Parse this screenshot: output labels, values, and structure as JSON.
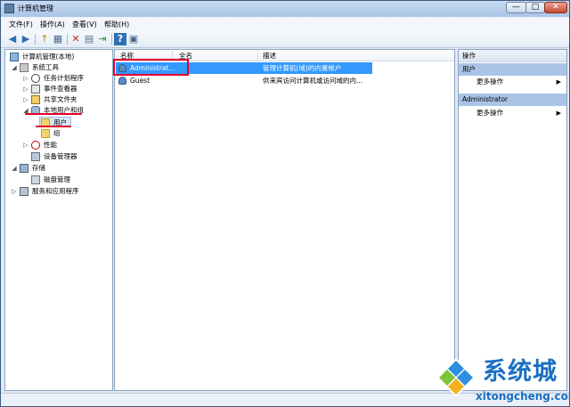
{
  "window": {
    "title": "计算机管理"
  },
  "window_controls": {
    "minimize": "—",
    "maximize": "□",
    "close": "✕"
  },
  "menubar": [
    {
      "label": "文件(F)"
    },
    {
      "label": "操作(A)"
    },
    {
      "label": "查看(V)"
    },
    {
      "label": "帮助(H)"
    }
  ],
  "toolbar": {
    "back": "◀",
    "forward": "▶",
    "up": "↑",
    "show_hide": "▦",
    "delete": "✕",
    "properties": "▤",
    "export": "⇥",
    "help": "?",
    "view": "▣"
  },
  "tree": [
    {
      "label": "计算机管理(本地)",
      "expander": "",
      "icon": "computer-icon"
    },
    {
      "label": "系统工具",
      "expander": "◢",
      "icon": "tools-icon"
    },
    {
      "label": "任务计划程序",
      "expander": "▷",
      "icon": "clock-icon"
    },
    {
      "label": "事件查看器",
      "expander": "▷",
      "icon": "event-log-icon"
    },
    {
      "label": "共享文件夹",
      "expander": "▷",
      "icon": "share-folder-icon"
    },
    {
      "label": "本地用户和组",
      "expander": "◢",
      "icon": "users-icon"
    },
    {
      "label": "用户",
      "expander": "",
      "icon": "folder-icon"
    },
    {
      "label": "组",
      "expander": "",
      "icon": "folder-icon"
    },
    {
      "label": "性能",
      "expander": "▷",
      "icon": "performance-icon"
    },
    {
      "label": "设备管理器",
      "expander": "",
      "icon": "device-manager-icon"
    },
    {
      "label": "存储",
      "expander": "◢",
      "icon": "storage-icon"
    },
    {
      "label": "磁盘管理",
      "expander": "",
      "icon": "disk-icon"
    },
    {
      "label": "服务和应用程序",
      "expander": "▷",
      "icon": "services-icon"
    }
  ],
  "list": {
    "columns": [
      "名称",
      "全名",
      "描述"
    ],
    "rows": [
      {
        "name": "Administrat...",
        "fullname": "",
        "description": "管理计算机(域)的内置帐户",
        "selected": true
      },
      {
        "name": "Guest",
        "fullname": "",
        "description": "供来宾访问计算机或访问域的内...",
        "selected": false
      }
    ]
  },
  "actions": {
    "title": "操作",
    "sections": [
      {
        "header": "用户",
        "items": [
          "更多操作"
        ]
      },
      {
        "header": "Administrator",
        "items": [
          "更多操作"
        ]
      }
    ],
    "arrow": "▶"
  },
  "watermark": {
    "title": "系统城",
    "url": "xitongcheng.com"
  },
  "colors": {
    "selection": "#3399ff",
    "annotation": "#e3002b",
    "brand": "#1a6fc2"
  }
}
